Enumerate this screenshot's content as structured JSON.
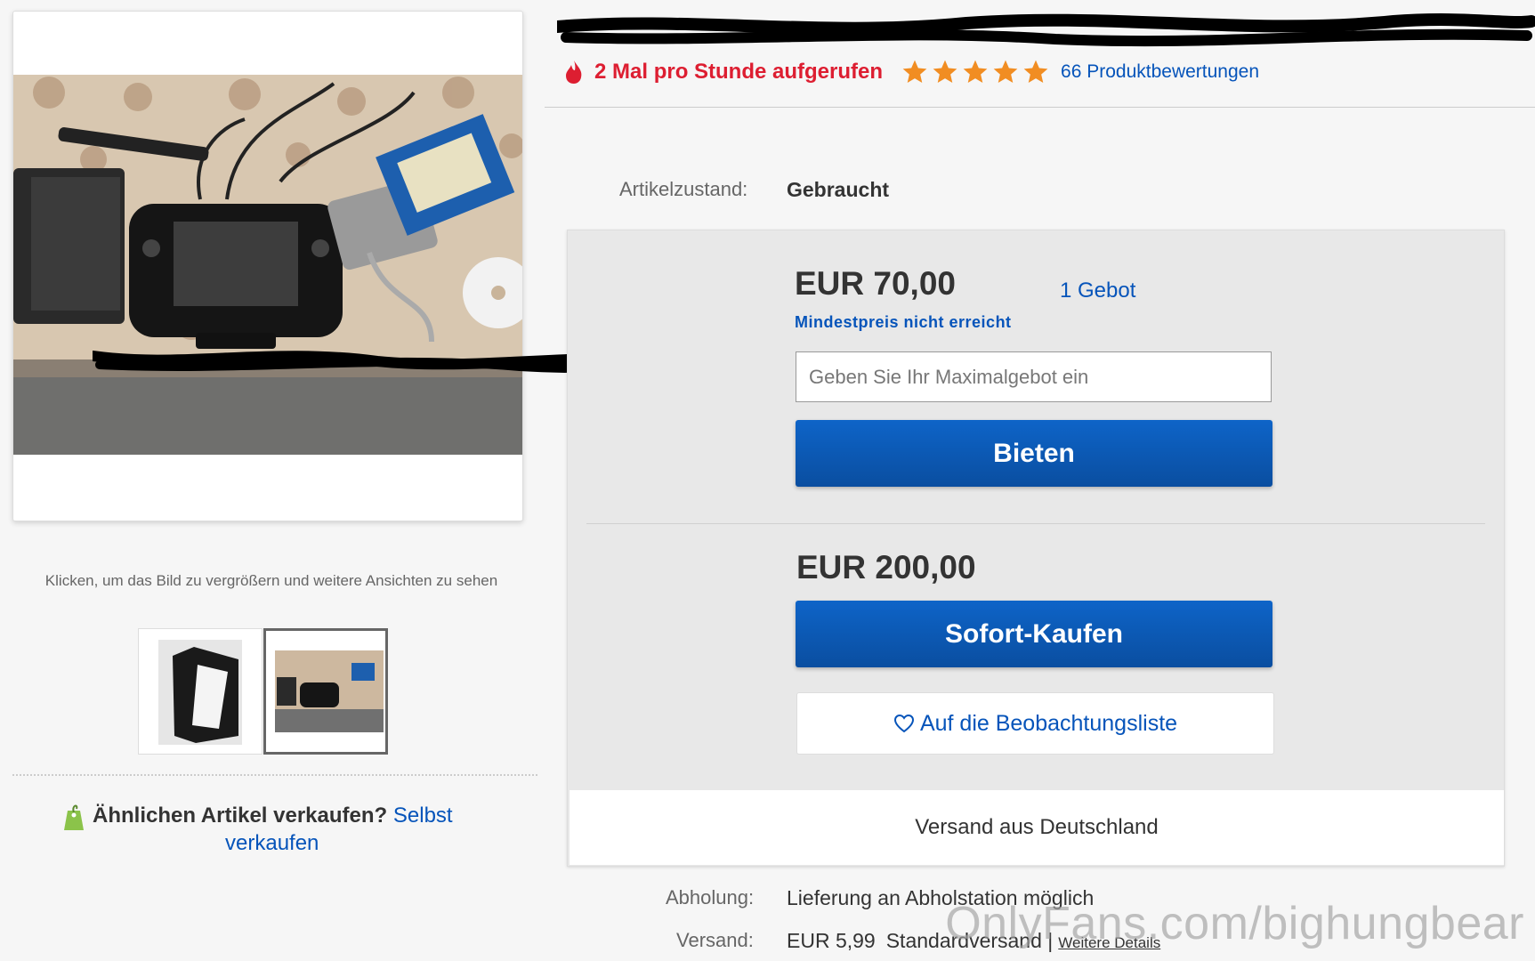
{
  "header": {
    "views_text": "2 Mal pro Stunde aufgerufen",
    "rating_stars": 5,
    "reviews_link": "66 Produktbewertungen"
  },
  "condition": {
    "label": "Artikelzustand:",
    "value": "Gebraucht"
  },
  "bid": {
    "price": "EUR 70,00",
    "bid_count": "1 Gebot",
    "reserve_note": "Mindestpreis nicht erreicht",
    "input_placeholder": "Geben Sie Ihr Maximalgebot ein",
    "button_label": "Bieten"
  },
  "buy_now": {
    "price": "EUR 200,00",
    "button_label": "Sofort-Kaufen",
    "watch_label": "Auf die Beobachtungsliste"
  },
  "shipping_origin": "Versand aus Deutschland",
  "pickup": {
    "label": "Abholung:",
    "value": "Lieferung an Abholstation möglich"
  },
  "shipping": {
    "label": "Versand:",
    "price": "EUR 5,99",
    "method": "Standardversand |",
    "details_link": "Weitere Details"
  },
  "gallery": {
    "enlarge_hint": "Klicken, um das Bild zu vergrößern und weitere Ansichten zu sehen",
    "thumbnail_count": 2,
    "selected_thumbnail": 2
  },
  "sell_similar": {
    "question": "Ähnlichen Artikel verkaufen?",
    "link_part1": "Selbst",
    "link_part2": "verkaufen"
  },
  "watermark": "OnlyFans.com/bighungbear",
  "colors": {
    "accent_blue": "#0654ba",
    "button_blue": "#0a58b8",
    "alert_red": "#dd1e31",
    "star_orange": "#f18d22"
  }
}
